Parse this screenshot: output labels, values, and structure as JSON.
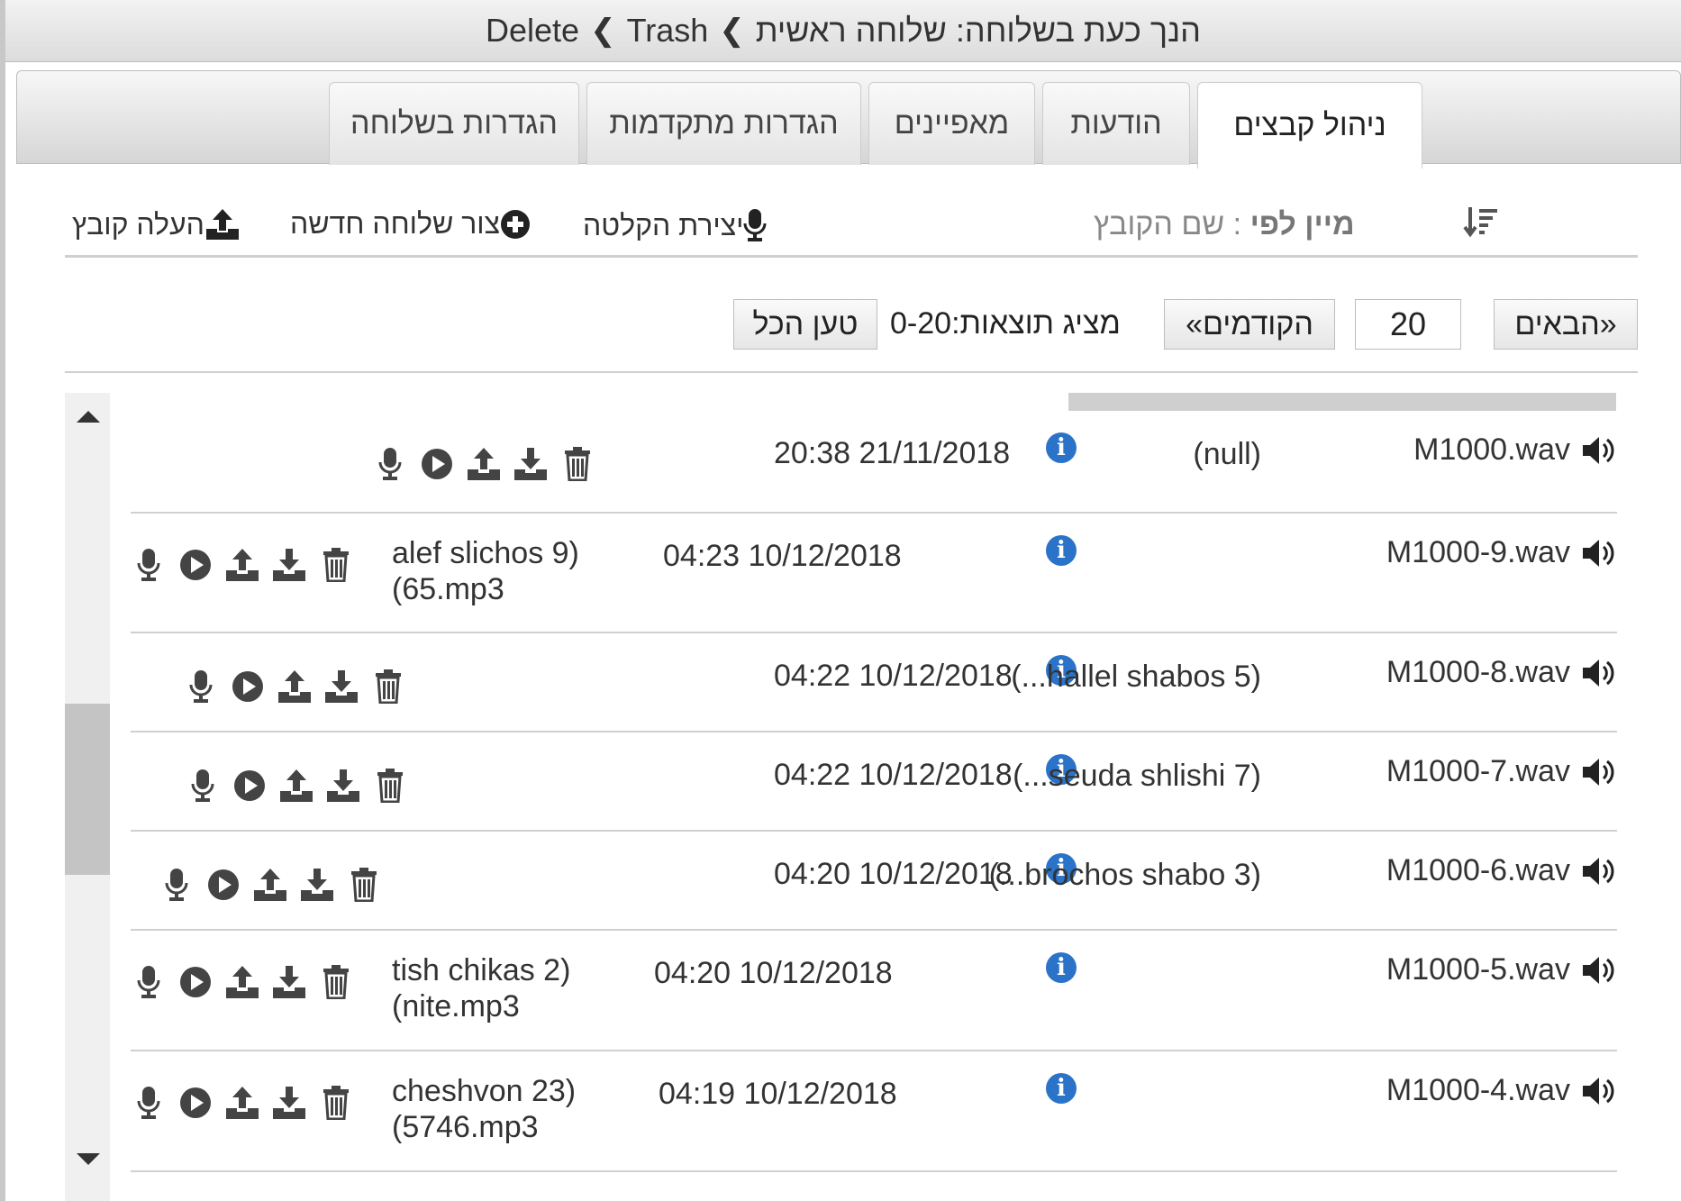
{
  "titlebar": {
    "current_label": "הנך כעת בשלוחה:",
    "breadcrumb": [
      "שלוחה ראשית",
      "Trash",
      "Delete"
    ]
  },
  "tabs": [
    {
      "label": "ניהול קבצים",
      "active": true
    },
    {
      "label": "הודעות",
      "active": false
    },
    {
      "label": "מאפיינים",
      "active": false
    },
    {
      "label": "הגדרות מתקדמות",
      "active": false
    },
    {
      "label": "הגדרות בשלוחה",
      "active": false
    }
  ],
  "toolbar": {
    "sort_label": "מיין לפי",
    "sort_value": ": שם הקובץ",
    "record_label": "יצירת הקלטה",
    "new_ext_label": "צור שלוחה חדשה",
    "upload_label": "העלה קובץ"
  },
  "pager": {
    "next_label": "«הבאים",
    "page_size": "20",
    "prev_label": "הקודמים»",
    "showing_label": "מציג תוצאות:",
    "range": "0-20",
    "load_all_label": "טען הכל"
  },
  "files": [
    {
      "name": "M1000.wav",
      "date": "20:38 21/11/2018",
      "desc": "(null)"
    },
    {
      "name": "M1000-9.wav",
      "date": "04:23 10/12/2018",
      "desc_lines": [
        "alef slichos 9)",
        "(65.mp3"
      ]
    },
    {
      "name": "M1000-8.wav",
      "date": "04:22 10/12/2018",
      "desc": "(...hallel shabos 5)"
    },
    {
      "name": "M1000-7.wav",
      "date": "04:22 10/12/2018",
      "desc": "(...seuda shlishi 7)"
    },
    {
      "name": "M1000-6.wav",
      "date": "04:20 10/12/2018",
      "desc": "(...brochos shabo 3)"
    },
    {
      "name": "M1000-5.wav",
      "date": "04:20 10/12/2018",
      "desc_lines": [
        "tish chikas 2)",
        "(nite.mp3"
      ]
    },
    {
      "name": "M1000-4.wav",
      "date": "04:19 10/12/2018",
      "desc_lines": [
        "cheshvon 23)",
        "(5746.mp3"
      ]
    }
  ],
  "colors": {
    "info": "#2a73c9",
    "tab_border": "#cccccc"
  }
}
